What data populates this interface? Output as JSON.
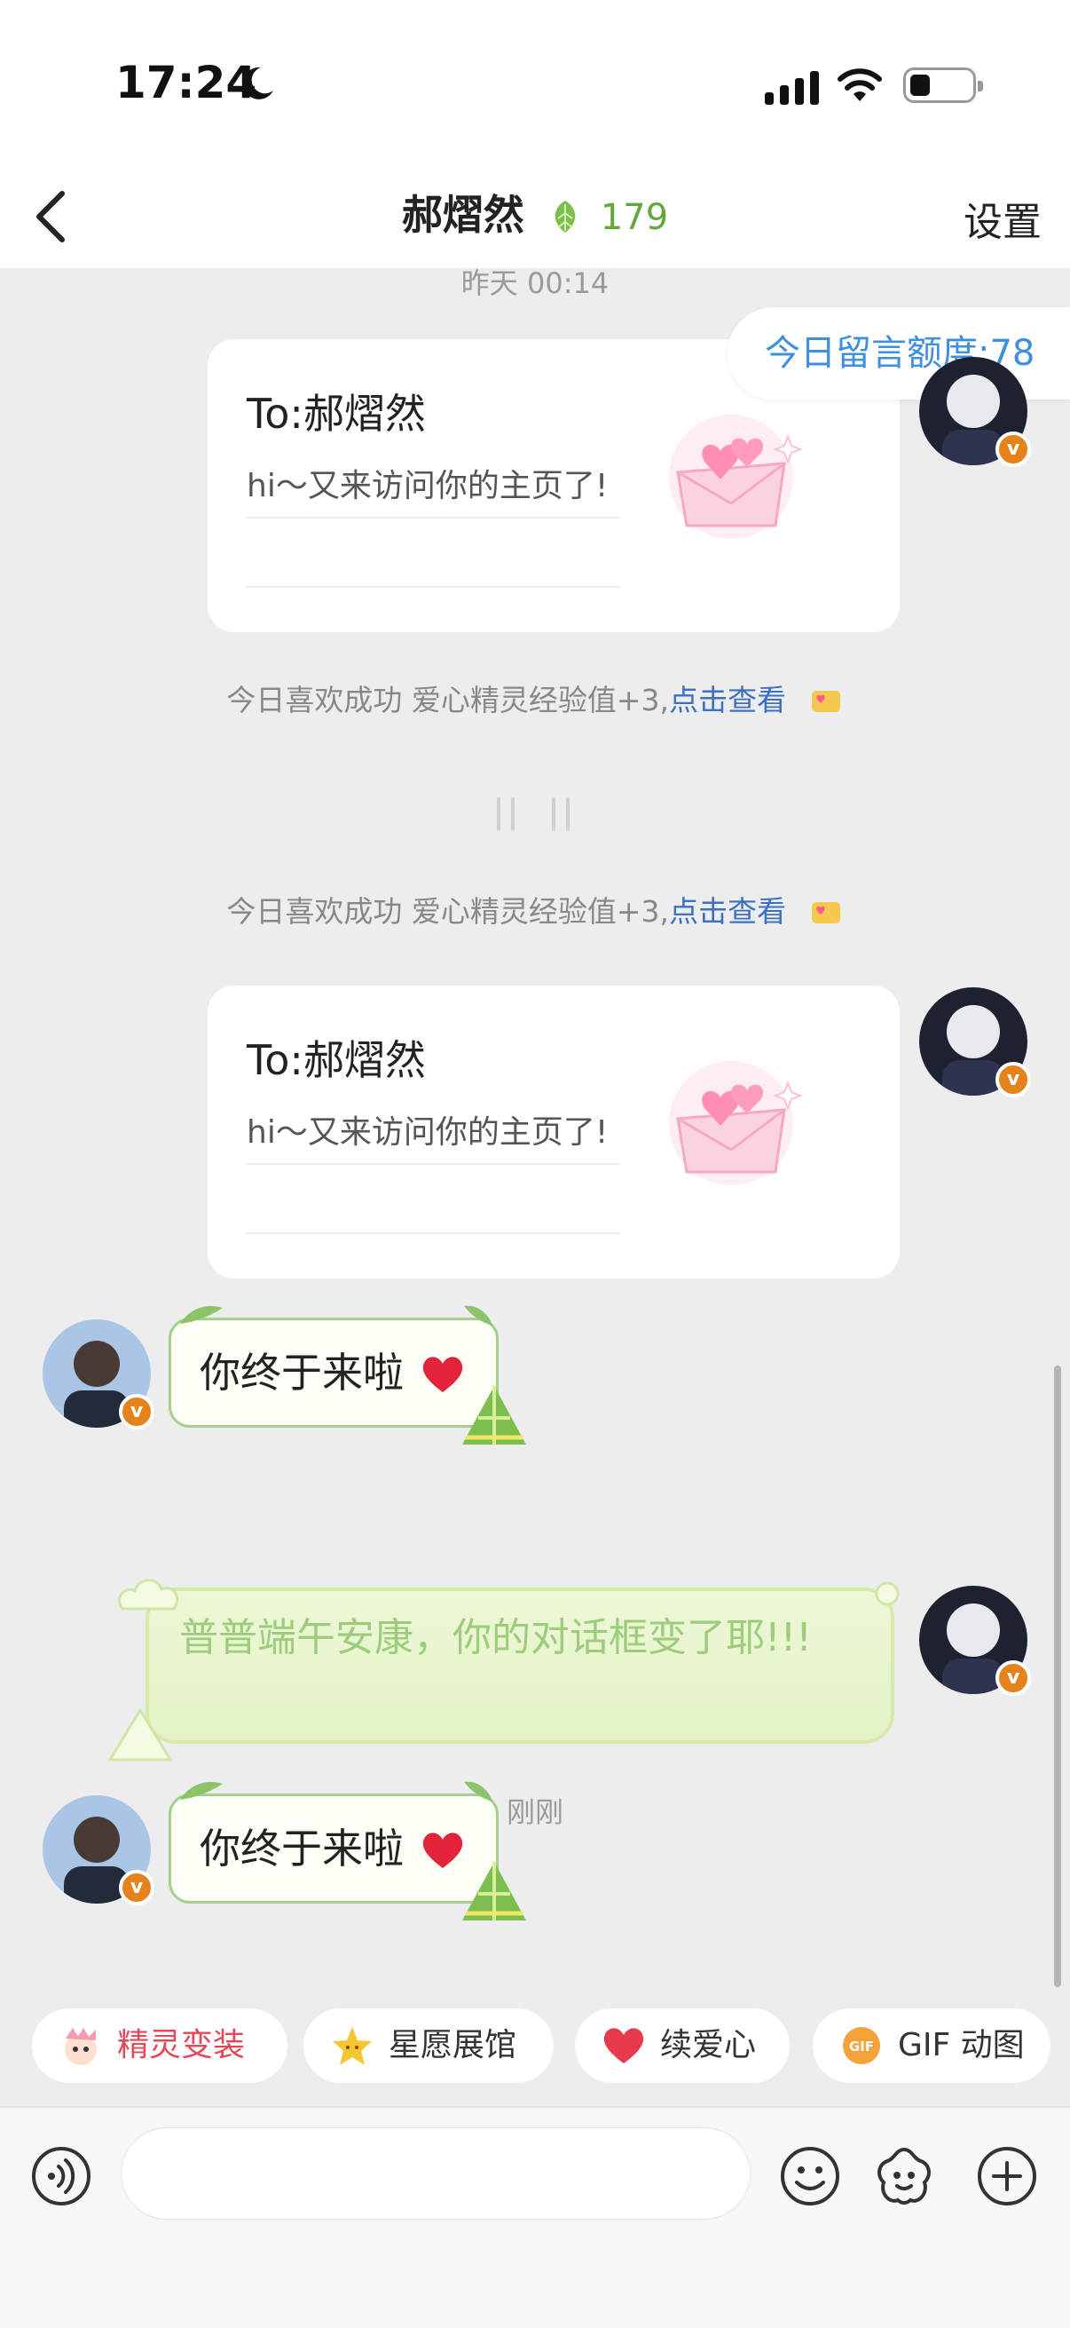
{
  "status": {
    "time": "17:24"
  },
  "header": {
    "title": "郝熠然",
    "leaf_count": "179",
    "settings": "设置"
  },
  "chat": {
    "timestamp_top": "昨天 00:14",
    "quota": "今日留言额度:78",
    "card1": {
      "to": "To:郝熠然",
      "msg": "hi～又来访问你的主页了!"
    },
    "sys1": {
      "text": "今日喜欢成功 爱心精灵经验值+3,",
      "link": "点击查看"
    },
    "sys2": {
      "text": "今日喜欢成功 爱心精灵经验值+3,",
      "link": "点击查看"
    },
    "card2": {
      "to": "To:郝熠然",
      "msg": "hi～又来访问你的主页了!"
    },
    "reply1": "你终于来啦",
    "timestamp_now": "刚刚",
    "my_msg": "普普端午安康，你的对话框变了耶!!!",
    "reply2": "你终于来啦"
  },
  "chips": [
    {
      "label": "精灵变装",
      "icon": "sprite-icon"
    },
    {
      "label": "星愿展馆",
      "icon": "star-icon"
    },
    {
      "label": "续爱心",
      "icon": "heart-icon"
    },
    {
      "label": "GIF 动图",
      "icon": "gif-icon"
    }
  ],
  "colors": {
    "accent_green": "#62a83d",
    "link_blue": "#3d6fc2",
    "quota_blue": "#3f8fe0",
    "chip_red": "#e64758"
  }
}
